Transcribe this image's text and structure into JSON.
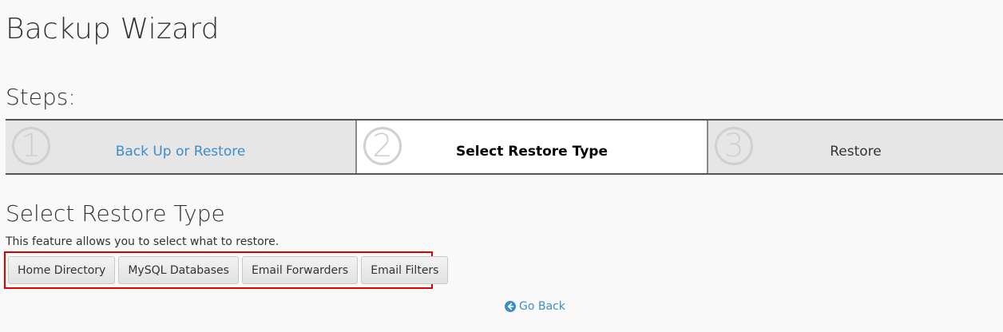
{
  "page": {
    "title": "Backup Wizard"
  },
  "steps": {
    "heading": "Steps:",
    "items": [
      {
        "number": "1",
        "label": "Back Up or Restore",
        "state": "link"
      },
      {
        "number": "2",
        "label": "Select Restore Type",
        "state": "current"
      },
      {
        "number": "3",
        "label": "Restore",
        "state": "upcoming"
      }
    ]
  },
  "section": {
    "title": "Select Restore Type",
    "description": "This feature allows you to select what to restore."
  },
  "restore_options": [
    {
      "label": "Home Directory"
    },
    {
      "label": "MySQL Databases"
    },
    {
      "label": "Email Forwarders"
    },
    {
      "label": "Email Filters"
    }
  ],
  "navigation": {
    "go_back_label": "Go Back",
    "go_back_icon": "arrow-circle-left-icon"
  },
  "colors": {
    "link": "#3c8dca",
    "highlight_border": "#e10000",
    "step_bg": "#e6e6e6",
    "active_step_bg": "#ffffff"
  }
}
